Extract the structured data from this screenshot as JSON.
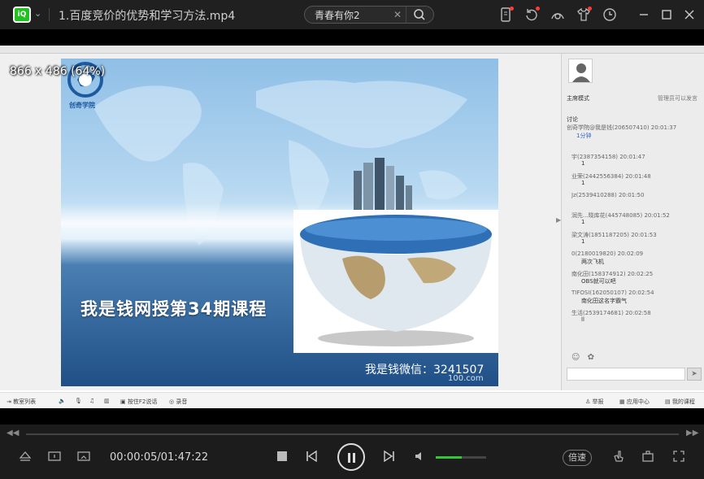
{
  "titlebar": {
    "app_logo": "iQ",
    "title": "1.百度竞价的优势和学习方法.mp4",
    "search": {
      "value": "青春有你2"
    },
    "icons": [
      "phone-icon",
      "refresh-icon",
      "skin-icon",
      "tshirt-icon",
      "history-icon",
      "minimize-icon",
      "maximize-icon",
      "close-icon"
    ]
  },
  "video": {
    "resolution_overlay": "866 x 486 (64%)",
    "slide": {
      "heading_prefix": "我是钱网授第",
      "heading_number": "34",
      "heading_suffix": "期课程",
      "wechat": "我是钱微信：3241507",
      "domain": "100.com",
      "logo_text": "创奇学院"
    },
    "panel": {
      "host_label": "主席模式",
      "mode_label": "管理员可以发言",
      "discussion_label": "讨论",
      "pinned": "创奇学院@我是钱(206507410) 20:01:37",
      "pinned_sub": "1分钟",
      "chat": [
        {
          "meta": "宇(2387354158) 20:01:47",
          "msg": "1"
        },
        {
          "meta": "业荣(2442556384) 20:01:48",
          "msg": "1"
        },
        {
          "meta": "Jz(2539410288) 20:01:50",
          "msg": ""
        },
        {
          "meta": "润先...晓库花(445748085) 20:01:52",
          "msg": "1"
        },
        {
          "meta": "梁文涛(1851187205) 20:01:53",
          "msg": "1"
        },
        {
          "meta": "0(2180019820) 20:02:09",
          "msg": "两次飞机"
        },
        {
          "meta": "南化田(158374912) 20:02:25",
          "msg": "OBS就可以吧"
        },
        {
          "meta": "TIFOSI(162050107) 20:02:54",
          "msg": "南化田这名字霸气"
        },
        {
          "meta": "生活(2539174681) 20:02:58",
          "msg": "ll"
        }
      ]
    },
    "bottom_toolbar": {
      "classroom_list": "教室列表",
      "hold_f2": "按住F2说话",
      "record": "录音",
      "report": "举报",
      "app_center": "应用中心",
      "my_courses": "我的课程"
    }
  },
  "player": {
    "time": "00:00:05/01:47:22",
    "volume_level": 0.52,
    "speed_label": "倍速",
    "accent_color": "#36c43a"
  }
}
